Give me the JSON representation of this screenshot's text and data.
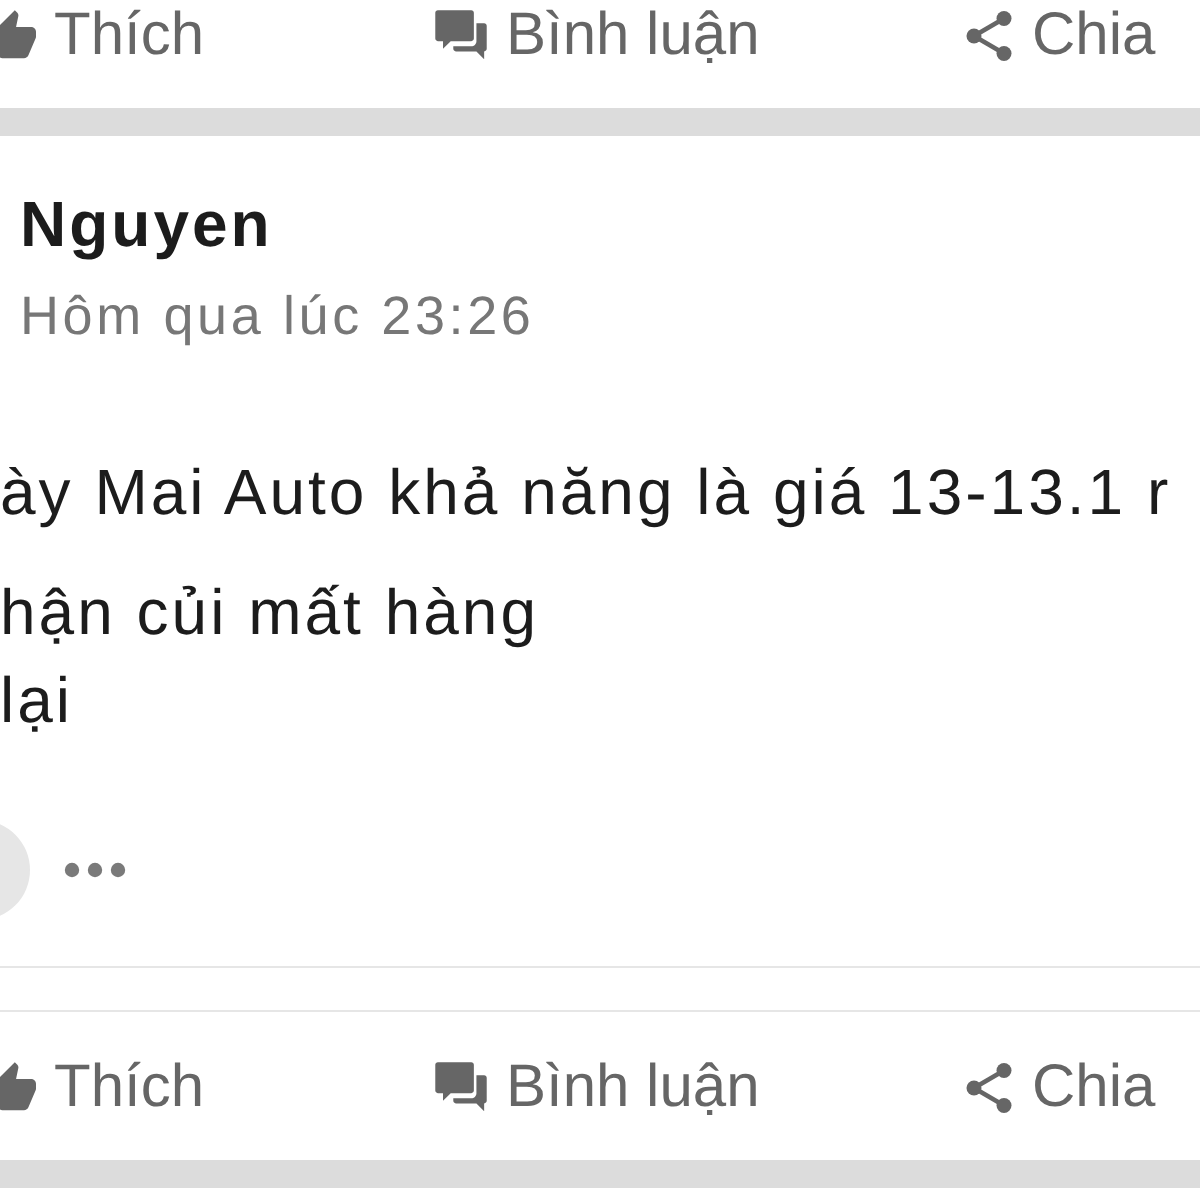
{
  "top_action_bar": {
    "buttons": [
      {
        "kind": "like",
        "label": "Thích"
      },
      {
        "kind": "comment",
        "label": "Bình luận"
      },
      {
        "kind": "share",
        "label": "Chia"
      }
    ]
  },
  "post": {
    "author": "Nguyen",
    "timestamp": "Hôm qua lúc 23:26",
    "body_lines": [
      "ày Mai Auto khả năng là giá 13-13.1 r",
      "hận củi mất hàng",
      "lại"
    ]
  },
  "bottom_action_bar": {
    "buttons": [
      {
        "kind": "like",
        "label": "Thích"
      },
      {
        "kind": "comment",
        "label": "Bình luận"
      },
      {
        "kind": "share",
        "label": "Chia"
      }
    ]
  }
}
